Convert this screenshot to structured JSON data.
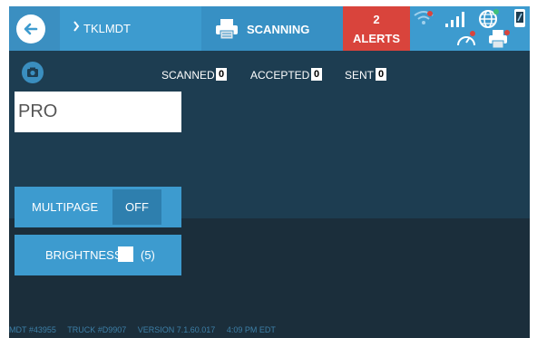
{
  "header": {
    "breadcrumb": "TKLMDT",
    "scan_label": "SCANNING",
    "alerts_count": "2",
    "alerts_label": "ALERTS"
  },
  "counters": [
    {
      "label": "SCANNED",
      "value": "0"
    },
    {
      "label": "ACCEPTED",
      "value": "0"
    },
    {
      "label": "SENT",
      "value": "0"
    }
  ],
  "pro_field": {
    "value": "PRO"
  },
  "multipage": {
    "label": "MULTIPAGE",
    "state": "OFF"
  },
  "brightness": {
    "label": "BRIGHTNESS",
    "value": "(5)"
  },
  "footer": {
    "mdt": "MDT #43955",
    "truck": "TRUCK #D9907",
    "version": "VERSION  7.1.60.017",
    "time": "4:09 PM EDT"
  },
  "icons": {
    "back": "arrow-left-icon",
    "scan": "printer-icon",
    "wifi": "wifi-icon",
    "signal": "signal-icon",
    "globe": "globe-icon",
    "phone": "phone-icon",
    "gauge": "speedometer-icon",
    "printer": "printer-icon",
    "camera": "camera-icon"
  },
  "colors": {
    "accent": "#3d9bcf",
    "alert": "#d9443c",
    "panel": "#1d3d51",
    "background": "#1b2e3b"
  }
}
